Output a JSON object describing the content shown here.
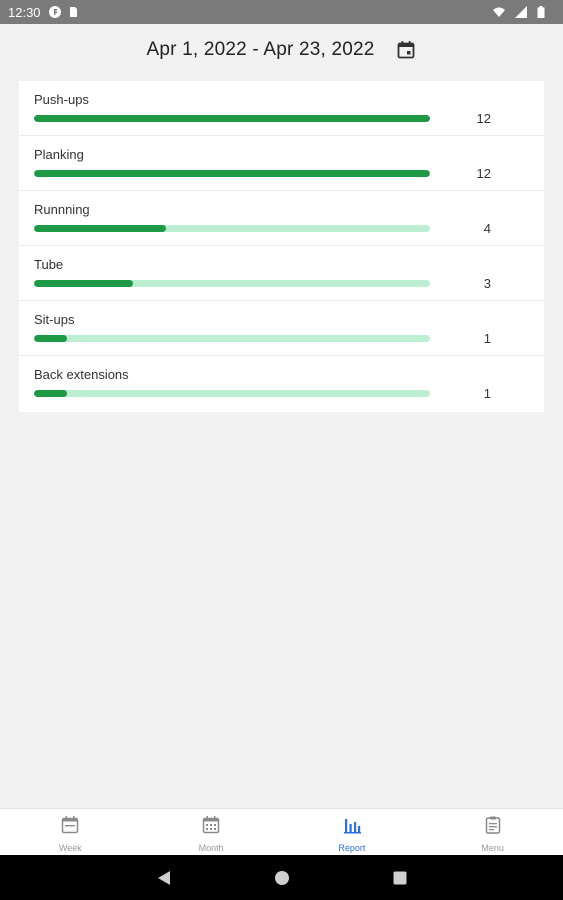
{
  "status_bar": {
    "time": "12:30",
    "icons": [
      "notification-f-icon",
      "sd-card-icon",
      "wifi-icon",
      "signal-icon",
      "battery-icon"
    ]
  },
  "header": {
    "date_range": "Apr 1, 2022 - Apr 23, 2022",
    "calendar_icon": "calendar-icon"
  },
  "colors": {
    "accent": "#1e9a44",
    "track": "#bcefd1",
    "active_nav": "#2f6fd8"
  },
  "exercises": [
    {
      "name": "Push-ups",
      "count": "12",
      "progress": 1.0
    },
    {
      "name": "Planking",
      "count": "12",
      "progress": 1.0
    },
    {
      "name": "Runnning",
      "count": "4",
      "progress": 0.333
    },
    {
      "name": "Tube",
      "count": "3",
      "progress": 0.25
    },
    {
      "name": "Sit-ups",
      "count": "1",
      "progress": 0.083
    },
    {
      "name": "Back extensions",
      "count": "1",
      "progress": 0.083
    }
  ],
  "bottom_nav": {
    "items": [
      {
        "label": "Week",
        "icon": "calendar-week-icon",
        "active": false
      },
      {
        "label": "Month",
        "icon": "calendar-month-icon",
        "active": false
      },
      {
        "label": "Report",
        "icon": "bar-chart-icon",
        "active": true
      },
      {
        "label": "Menu",
        "icon": "clipboard-icon",
        "active": false
      }
    ]
  },
  "android_nav": [
    "back-icon",
    "home-icon",
    "recents-icon"
  ]
}
